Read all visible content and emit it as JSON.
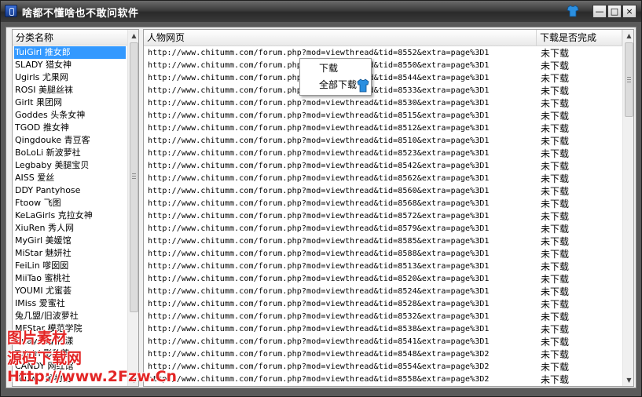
{
  "window": {
    "title": "啥都不懂啥也不敢问软件",
    "min_label": "—",
    "max_label": "□",
    "close_label": "×"
  },
  "categories": {
    "header": "分类名称",
    "items": [
      "TuiGirl 推女郎",
      "SLADY 猎女神",
      "Ugirls 尤果网",
      "ROSI 美腿丝袜",
      "Girlt 果团网",
      "Goddes 头条女神",
      "TGOD 推女神",
      "Qingdouke 青豆客",
      "BoLoLi 新波萝社",
      "Legbaby 美腿宝贝",
      "AISS 爱丝",
      "DDY Pantyhose",
      "Ftoow 飞图",
      "KeLaGirls 克拉女神",
      "XiuRen 秀人网",
      "MyGirl 美媛馆",
      "MiStar 魅妍社",
      "FeiLin 嗲囡囡",
      "MiiTao 蜜桃社",
      "YOUMI 尤蜜荟",
      "IMiss 爱蜜社",
      "兔几盟/旧波萝社",
      "MFStar 模范学院",
      "Huayang 花漾",
      "Tuigirl 影私荟",
      "CANDY 网红馆",
      "Youwu 尤物馆"
    ],
    "selected_index": 0
  },
  "table": {
    "col_url": "人物网页",
    "col_status": "下载是否完成",
    "rows": [
      {
        "url": "http://www.chitumm.com/forum.php?mod=viewthread&tid=8552&extra=page%3D1",
        "status": "未下载"
      },
      {
        "url": "http://www.chitumm.com/forum.php?mod=viewthread&tid=8550&extra=page%3D1",
        "status": "未下载"
      },
      {
        "url": "http://www.chitumm.com/forum.php?mod=viewthread&tid=8544&extra=page%3D1",
        "status": "未下载"
      },
      {
        "url": "http://www.chitumm.com/forum.php?mod=viewthread&tid=8533&extra=page%3D1",
        "status": "未下载"
      },
      {
        "url": "http://www.chitumm.com/forum.php?mod=viewthread&tid=8530&extra=page%3D1",
        "status": "未下载"
      },
      {
        "url": "http://www.chitumm.com/forum.php?mod=viewthread&tid=8515&extra=page%3D1",
        "status": "未下载"
      },
      {
        "url": "http://www.chitumm.com/forum.php?mod=viewthread&tid=8512&extra=page%3D1",
        "status": "未下载"
      },
      {
        "url": "http://www.chitumm.com/forum.php?mod=viewthread&tid=8510&extra=page%3D1",
        "status": "未下载"
      },
      {
        "url": "http://www.chitumm.com/forum.php?mod=viewthread&tid=8523&extra=page%3D1",
        "status": "未下载"
      },
      {
        "url": "http://www.chitumm.com/forum.php?mod=viewthread&tid=8542&extra=page%3D1",
        "status": "未下载"
      },
      {
        "url": "http://www.chitumm.com/forum.php?mod=viewthread&tid=8562&extra=page%3D1",
        "status": "未下载"
      },
      {
        "url": "http://www.chitumm.com/forum.php?mod=viewthread&tid=8560&extra=page%3D1",
        "status": "未下载"
      },
      {
        "url": "http://www.chitumm.com/forum.php?mod=viewthread&tid=8568&extra=page%3D1",
        "status": "未下载"
      },
      {
        "url": "http://www.chitumm.com/forum.php?mod=viewthread&tid=8572&extra=page%3D1",
        "status": "未下载"
      },
      {
        "url": "http://www.chitumm.com/forum.php?mod=viewthread&tid=8579&extra=page%3D1",
        "status": "未下载"
      },
      {
        "url": "http://www.chitumm.com/forum.php?mod=viewthread&tid=8585&extra=page%3D1",
        "status": "未下载"
      },
      {
        "url": "http://www.chitumm.com/forum.php?mod=viewthread&tid=8588&extra=page%3D1",
        "status": "未下载"
      },
      {
        "url": "http://www.chitumm.com/forum.php?mod=viewthread&tid=8513&extra=page%3D1",
        "status": "未下载"
      },
      {
        "url": "http://www.chitumm.com/forum.php?mod=viewthread&tid=8520&extra=page%3D1",
        "status": "未下载"
      },
      {
        "url": "http://www.chitumm.com/forum.php?mod=viewthread&tid=8524&extra=page%3D1",
        "status": "未下载"
      },
      {
        "url": "http://www.chitumm.com/forum.php?mod=viewthread&tid=8528&extra=page%3D1",
        "status": "未下载"
      },
      {
        "url": "http://www.chitumm.com/forum.php?mod=viewthread&tid=8532&extra=page%3D1",
        "status": "未下载"
      },
      {
        "url": "http://www.chitumm.com/forum.php?mod=viewthread&tid=8538&extra=page%3D1",
        "status": "未下载"
      },
      {
        "url": "http://www.chitumm.com/forum.php?mod=viewthread&tid=8541&extra=page%3D1",
        "status": "未下载"
      },
      {
        "url": "http://www.chitumm.com/forum.php?mod=viewthread&tid=8548&extra=page%3D2",
        "status": "未下载"
      },
      {
        "url": "http://www.chitumm.com/forum.php?mod=viewthread&tid=8554&extra=page%3D2",
        "status": "未下载"
      },
      {
        "url": "http://www.chitumm.com/forum.php?mod=viewthread&tid=8558&extra=page%3D2",
        "status": "未下载"
      }
    ]
  },
  "context_menu": {
    "items": [
      "下载",
      "全部下载"
    ]
  },
  "watermark": {
    "line1": "图片素材",
    "line2": "源码下载网",
    "line3": "Http://www.2Fzw.Cn"
  },
  "colors": {
    "selection": "#3399ff",
    "watermark": "#e32626",
    "titlebar": "#3c3c3c"
  }
}
